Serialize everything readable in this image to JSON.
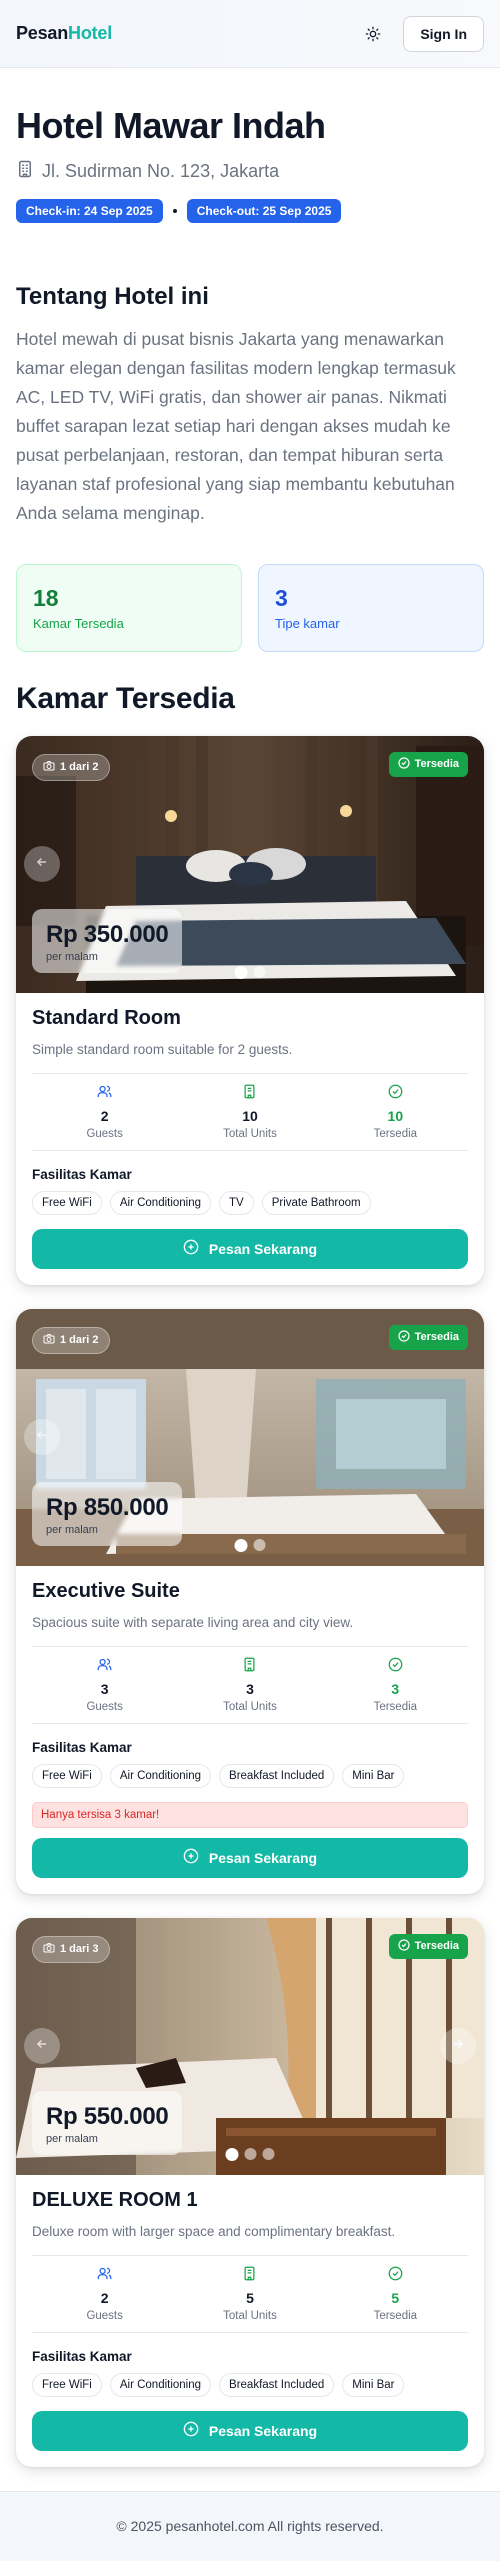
{
  "header": {
    "logo_part1": "Pesan",
    "logo_part2": "Hotel",
    "signin_label": "Sign In",
    "theme_icon": "sun-icon"
  },
  "hotel": {
    "name": "Hotel Mawar Indah",
    "address": "Jl. Sudirman No. 123, Jakarta",
    "checkin": "Check-in: 24 Sep 2025",
    "checkout": "Check-out: 25 Sep 2025"
  },
  "about": {
    "title": "Tentang Hotel ini",
    "text": "Hotel mewah di pusat bisnis Jakarta yang menawarkan kamar elegan dengan fasilitas modern lengkap termasuk AC, LED TV, WiFi gratis, dan shower air panas. Nikmati buffet sarapan lezat setiap hari dengan akses mudah ke pusat perbelanjaan, restoran, dan tempat hiburan serta layanan staf profesional yang siap membantu kebutuhan Anda selama menginap."
  },
  "stats": {
    "available_count": "18",
    "available_label": "Kamar Tersedia",
    "types_count": "3",
    "types_label": "Tipe kamar"
  },
  "rooms_title": "Kamar Tersedia",
  "rooms": [
    {
      "counter": "1 dari 2",
      "badge": "Tersedia",
      "price": "Rp 350.000",
      "per_night": "per malam",
      "name": "Standard Room",
      "desc": "Simple standard room suitable for 2 guests.",
      "guests": "2",
      "guests_label": "Guests",
      "units": "10",
      "units_label": "Total Units",
      "available": "10",
      "available_label": "Tersedia",
      "fac_title": "Fasilitas Kamar",
      "facilities": [
        "Free WiFi",
        "Air Conditioning",
        "TV",
        "Private Bathroom"
      ],
      "warning": "",
      "book_label": "Pesan Sekarang"
    },
    {
      "counter": "1 dari 2",
      "badge": "Tersedia",
      "price": "Rp 850.000",
      "per_night": "per malam",
      "name": "Executive Suite",
      "desc": "Spacious suite with separate living area and city view.",
      "guests": "3",
      "guests_label": "Guests",
      "units": "3",
      "units_label": "Total Units",
      "available": "3",
      "available_label": "Tersedia",
      "fac_title": "Fasilitas Kamar",
      "facilities": [
        "Free WiFi",
        "Air Conditioning",
        "Breakfast Included",
        "Mini Bar"
      ],
      "warning": "Hanya tersisa 3 kamar!",
      "book_label": "Pesan Sekarang"
    },
    {
      "counter": "1 dari 3",
      "badge": "Tersedia",
      "price": "Rp 550.000",
      "per_night": "per malam",
      "name": "DELUXE ROOM 1",
      "desc": "Deluxe room with larger space and complimentary breakfast.",
      "guests": "2",
      "guests_label": "Guests",
      "units": "5",
      "units_label": "Total Units",
      "available": "5",
      "available_label": "Tersedia",
      "fac_title": "Fasilitas Kamar",
      "facilities": [
        "Free WiFi",
        "Air Conditioning",
        "Breakfast Included",
        "Mini Bar"
      ],
      "warning": "",
      "book_label": "Pesan Sekarang"
    }
  ],
  "footer": {
    "text": "© 2025 pesanhotel.com All rights reserved."
  },
  "colors": {
    "accent": "#14b8a6",
    "primary_blue": "#2563eb",
    "success": "#16a34a",
    "danger": "#dc2626"
  }
}
